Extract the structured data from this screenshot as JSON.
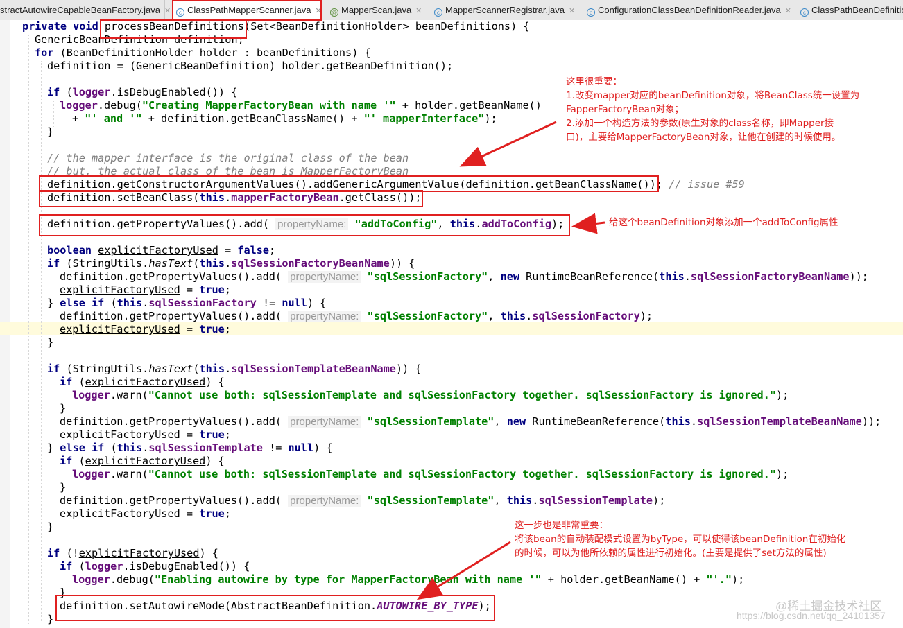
{
  "tabs": [
    {
      "label": "stractAutowireCapableBeanFactory.java",
      "active": false,
      "icon": "none"
    },
    {
      "label": "ClassPathMapperScanner.java",
      "active": true,
      "icon": "class-icon"
    },
    {
      "label": "MapperScan.java",
      "active": false,
      "icon": "annotation-icon"
    },
    {
      "label": "MapperScannerRegistrar.java",
      "active": false,
      "icon": "class-icon"
    },
    {
      "label": "ConfigurationClassBeanDefinitionReader.java",
      "active": false,
      "icon": "class-icon"
    },
    {
      "label": "ClassPathBeanDefinitio",
      "active": false,
      "icon": "class-icon"
    }
  ],
  "code": {
    "l1_a": "private void ",
    "l1_b": "processBeanDefinitions",
    "l1_c": "(Set<BeanDefinitionHolder> beanDefinitions) {",
    "l2": "GenericBeanDefinition definition;",
    "l3_kw": "for",
    "l3_rest": " (BeanDefinitionHolder holder : beanDefinitions) {",
    "l4": "definition = (GenericBeanDefinition) holder.getBeanDefinition();",
    "l6_a": "if",
    "l6_b": " (",
    "l6_c": "logger",
    "l6_d": ".isDebugEnabled()) {",
    "l7_a": "logger",
    "l7_b": ".debug(",
    "l7_c": "\"Creating MapperFactoryBean with name '\"",
    "l7_d": " + holder.getBeanName()",
    "l8_a": "+ ",
    "l8_b": "\"' and '\"",
    "l8_c": " + definition.getBeanClassName() + ",
    "l8_d": "\"' mapperInterface\"",
    "l8_e": ");",
    "l9": "}",
    "l11": "// the mapper interface is the original class of the bean",
    "l12": "// but, the actual class of the bean is MapperFactoryBean",
    "l13_a": "definition.getConstructorArgumentValues().addGenericArgumentValue(definition.getBeanClassName()); ",
    "l13_b": "// issue #59",
    "l14_a": "definition.setBeanClass(",
    "l14_b": "this",
    "l14_c": ".",
    "l14_d": "mapperFactoryBean",
    "l14_e": ".getClass());",
    "l16_a": "definition.getPropertyValues().add( ",
    "hint": "propertyName:",
    "l16_c": "\"addToConfig\"",
    "l16_d": ", ",
    "l16_e": "this",
    "l16_f": ".",
    "l16_g": "addToConfig",
    "l16_h": ");",
    "l18_a": "boolean ",
    "l18_b": "explicitFactoryUsed",
    "l18_c": " = ",
    "l18_d": "false",
    "l18_e": ";",
    "l19_a": "if",
    "l19_b": " (StringUtils.",
    "l19_c": "hasText",
    "l19_d": "(",
    "l19_e": "this",
    "l19_f": ".",
    "l19_g": "sqlSessionFactoryBeanName",
    "l19_h": ")) {",
    "l20_a": "definition.getPropertyValues().add( ",
    "l20_c": "\"sqlSessionFactory\"",
    "l20_d": ", ",
    "l20_e": "new",
    "l20_f": " RuntimeBeanReference(",
    "l20_g": "this",
    "l20_h": ".",
    "l20_i": "sqlSessionFactoryBeanName",
    "l20_j": "));",
    "l21_a": "explicitFactoryUsed",
    "l21_b": " = ",
    "l21_c": "true",
    "l21_d": ";",
    "l22_a": "} ",
    "l22_b": "else if",
    "l22_c": " (",
    "l22_d": "this",
    "l22_e": ".",
    "l22_f": "sqlSessionFactory",
    "l22_g": " != ",
    "l22_h": "null",
    "l22_i": ") {",
    "l23_c": "\"sqlSessionFactory\"",
    "l23_g": "this",
    "l23_i": "sqlSessionFactory",
    "l23_j": ");",
    "l25": "}",
    "l27_a": "if",
    "l27_b": " (StringUtils.",
    "l27_c": "hasText",
    "l27_e": "this",
    "l27_g": "sqlSessionTemplateBeanName",
    "l28_a": "if",
    "l28_b": " (",
    "l28_c": "explicitFactoryUsed",
    "l28_d": ") {",
    "l29_a": "logger",
    "l29_b": ".warn(",
    "l29_c": "\"Cannot use both: sqlSessionTemplate and sqlSessionFactory together. sqlSessionFactory is ignored.\"",
    "l29_d": ");",
    "l30": "}",
    "l31_c": "\"sqlSessionTemplate\"",
    "l31_e": "new",
    "l31_f": " RuntimeBeanReference(",
    "l31_g": "this",
    "l31_i": "sqlSessionTemplateBeanName",
    "l31_j": "));",
    "l33_b": "else if",
    "l33_d": "this",
    "l33_f": "sqlSessionTemplate",
    "l33_h": "null",
    "l36_c": "\"sqlSessionTemplate\"",
    "l36_g": "this",
    "l36_i": "sqlSessionTemplate",
    "l36_j": ");",
    "l38": "}",
    "l40_a": "if",
    "l40_b": " (!",
    "l40_c": "explicitFactoryUsed",
    "l40_d": ") {",
    "l41_a": "if",
    "l41_b": " (",
    "l41_c": "logger",
    "l41_d": ".isDebugEnabled()) {",
    "l42_a": "logger",
    "l42_b": ".debug(",
    "l42_c": "\"Enabling autowire by type for MapperFactoryBean with name '\"",
    "l42_d": " + holder.getBeanName() + ",
    "l42_e": "\"'.\"",
    "l42_f": ");",
    "l43": "}",
    "l44_a": "definition.setAutowireMode(AbstractBeanDefinition.",
    "l44_b": "AUTOWIRE_BY_TYPE",
    "l44_c": ");",
    "l45": "}"
  },
  "annotations": {
    "note1": "这里很重要：\n1.改变mapper对应的beanDefinition对象，将BeanClass统一设置为\nFapperFactoryBean对象；\n2.添加一个构造方法的参数(原生对象的class名称，即Mapper接\n口)，主要给MapperFactoryBean对象，让他在创建的时候使用。",
    "note2": "给这个beanDefinition对象添加一个addToConfig属性",
    "note3": "这一步也是非常重要：\n将该bean的自动装配模式设置为byType，可以使得该beanDefinition在初始化\n的时候，可以为他所依赖的属性进行初始化。(主要是提供了set方法的属性)",
    "color": "#e02020"
  },
  "watermark": {
    "brand": "@稀土掘金技术社区",
    "url": "https://blog.csdn.net/qq_24101357"
  }
}
